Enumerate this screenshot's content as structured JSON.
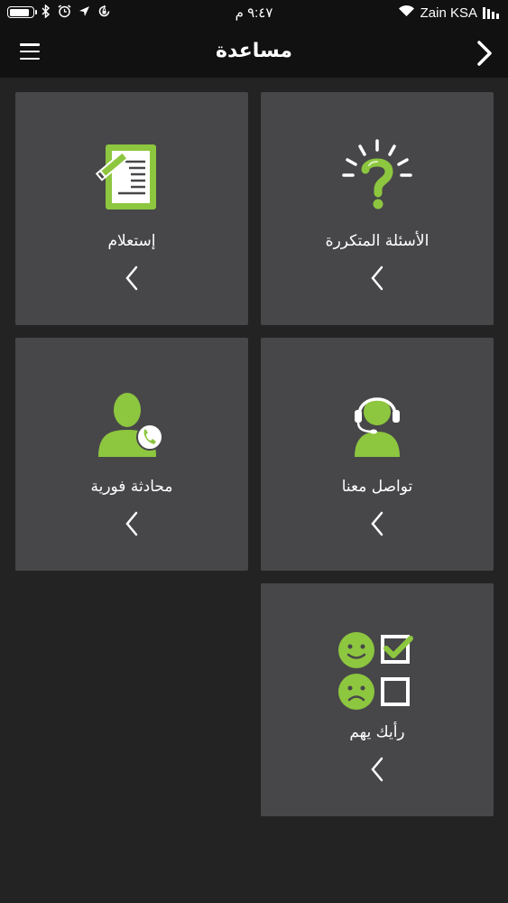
{
  "status_bar": {
    "carrier": "Zain KSA",
    "time": "٩:٤٧ م",
    "battery_level": 0.9
  },
  "header": {
    "title": "مساعدة"
  },
  "tiles": [
    {
      "id": "faq",
      "label": "الأسئلة المتكررة",
      "icon": "lightbulb-question-icon"
    },
    {
      "id": "inquiry",
      "label": "إستعلام",
      "icon": "document-pen-icon"
    },
    {
      "id": "contact",
      "label": "تواصل معنا",
      "icon": "headset-agent-icon"
    },
    {
      "id": "chat",
      "label": "محادثة فورية",
      "icon": "person-phone-icon"
    },
    {
      "id": "opinion",
      "label": "رأيك يهم",
      "icon": "feedback-faces-icon"
    }
  ],
  "colors": {
    "accent": "#8dc63f",
    "tile_bg": "#474749",
    "page_bg": "#232324",
    "bar_bg": "#111112"
  }
}
